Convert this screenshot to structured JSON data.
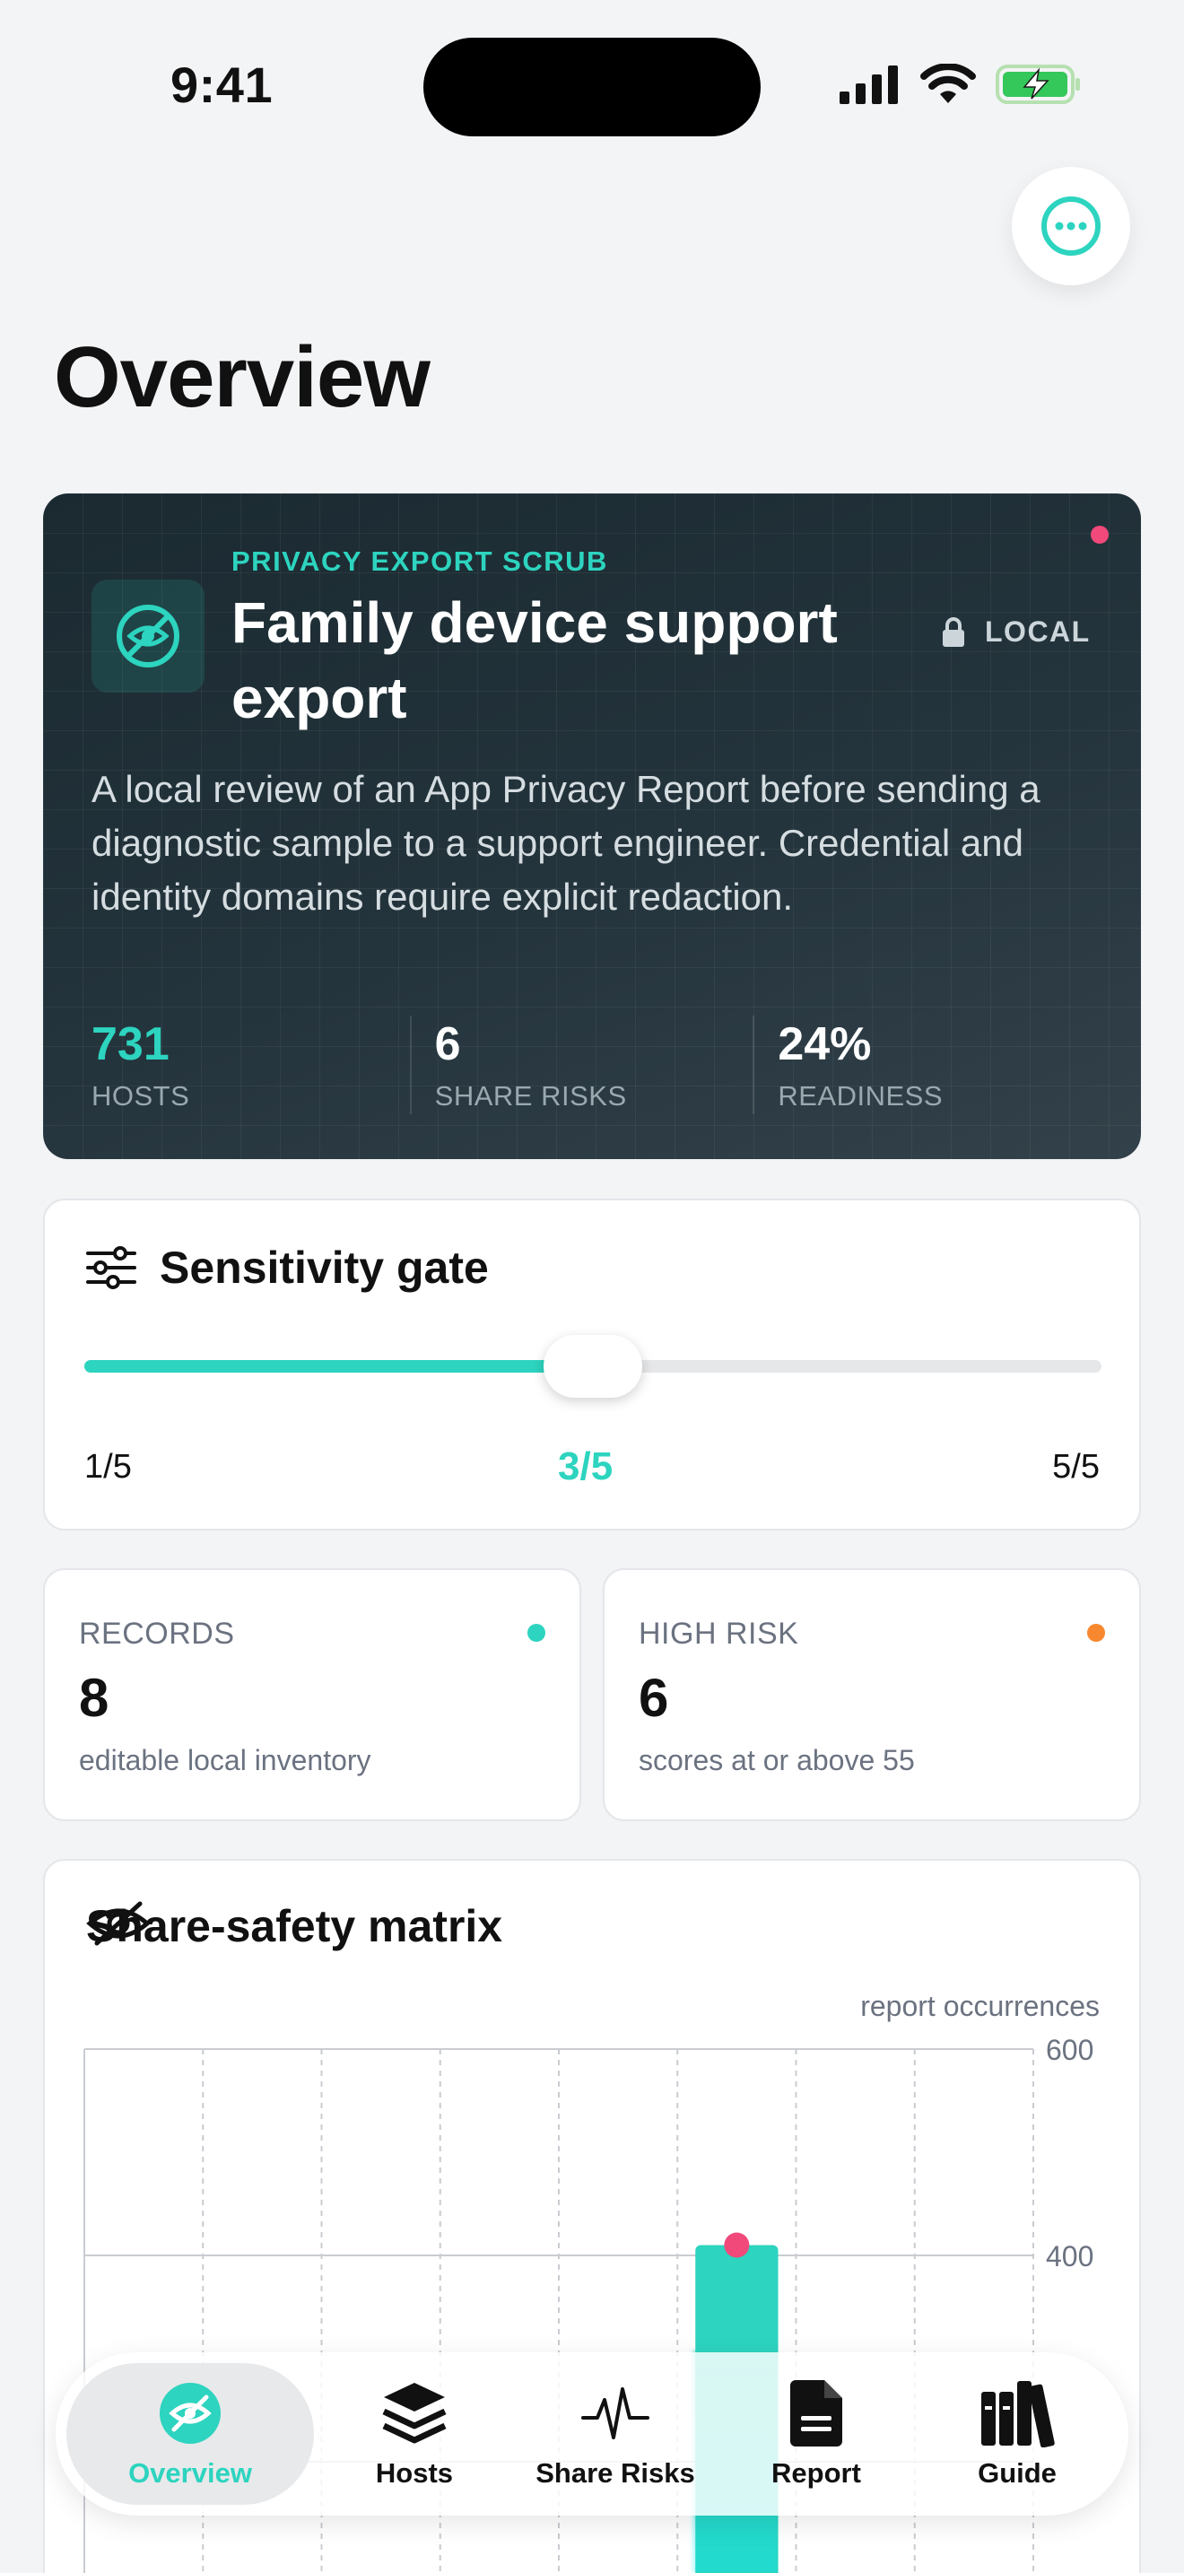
{
  "status_bar": {
    "time": "9:41"
  },
  "page": {
    "title": "Overview"
  },
  "hero": {
    "kicker": "PRIVACY EXPORT SCRUB",
    "title": "Family device support export",
    "badge": "LOCAL",
    "description": "A local review of an App Privacy Report before sending a diagnostic sample to a support engineer. Credential and identity domains require explicit redaction.",
    "stats": [
      {
        "value": "731",
        "label": "HOSTS"
      },
      {
        "value": "6",
        "label": "SHARE RISKS"
      },
      {
        "value": "24%",
        "label": "READINESS"
      }
    ],
    "colors": {
      "accent": "#2dd4bf",
      "alert_dot": "#f0497a"
    }
  },
  "sensitivity": {
    "title": "Sensitivity gate",
    "min_label": "1/5",
    "current_label": "3/5",
    "max_label": "5/5",
    "value": 3,
    "max": 5
  },
  "summary": {
    "records": {
      "label": "RECORDS",
      "value": "8",
      "sub": "editable local inventory",
      "dot_color": "#2dd4bf"
    },
    "high_risk": {
      "label": "HIGH RISK",
      "value": "6",
      "sub": "scores at or above 55",
      "dot_color": "#f7882f"
    }
  },
  "matrix": {
    "title": "Share-safety matrix",
    "axis_unit": "report occurrences",
    "ticks": [
      "600",
      "400"
    ]
  },
  "chart_data": {
    "type": "bar",
    "title": "Share-safety matrix",
    "ylabel": "report occurrences",
    "ylim": [
      0,
      600
    ],
    "y_ticks": [
      600,
      400
    ],
    "values": [
      null,
      null,
      null,
      null,
      null,
      410,
      null,
      null
    ],
    "marker_color": "#f0497a",
    "bar_color": "#2dd4bf"
  },
  "tabs": [
    {
      "label": "Overview",
      "icon": "eye-slash-icon",
      "active": true
    },
    {
      "label": "Hosts",
      "icon": "layers-icon",
      "active": false
    },
    {
      "label": "Share Risks",
      "icon": "pulse-icon",
      "active": false
    },
    {
      "label": "Report",
      "icon": "document-icon",
      "active": false
    },
    {
      "label": "Guide",
      "icon": "books-icon",
      "active": false
    }
  ]
}
